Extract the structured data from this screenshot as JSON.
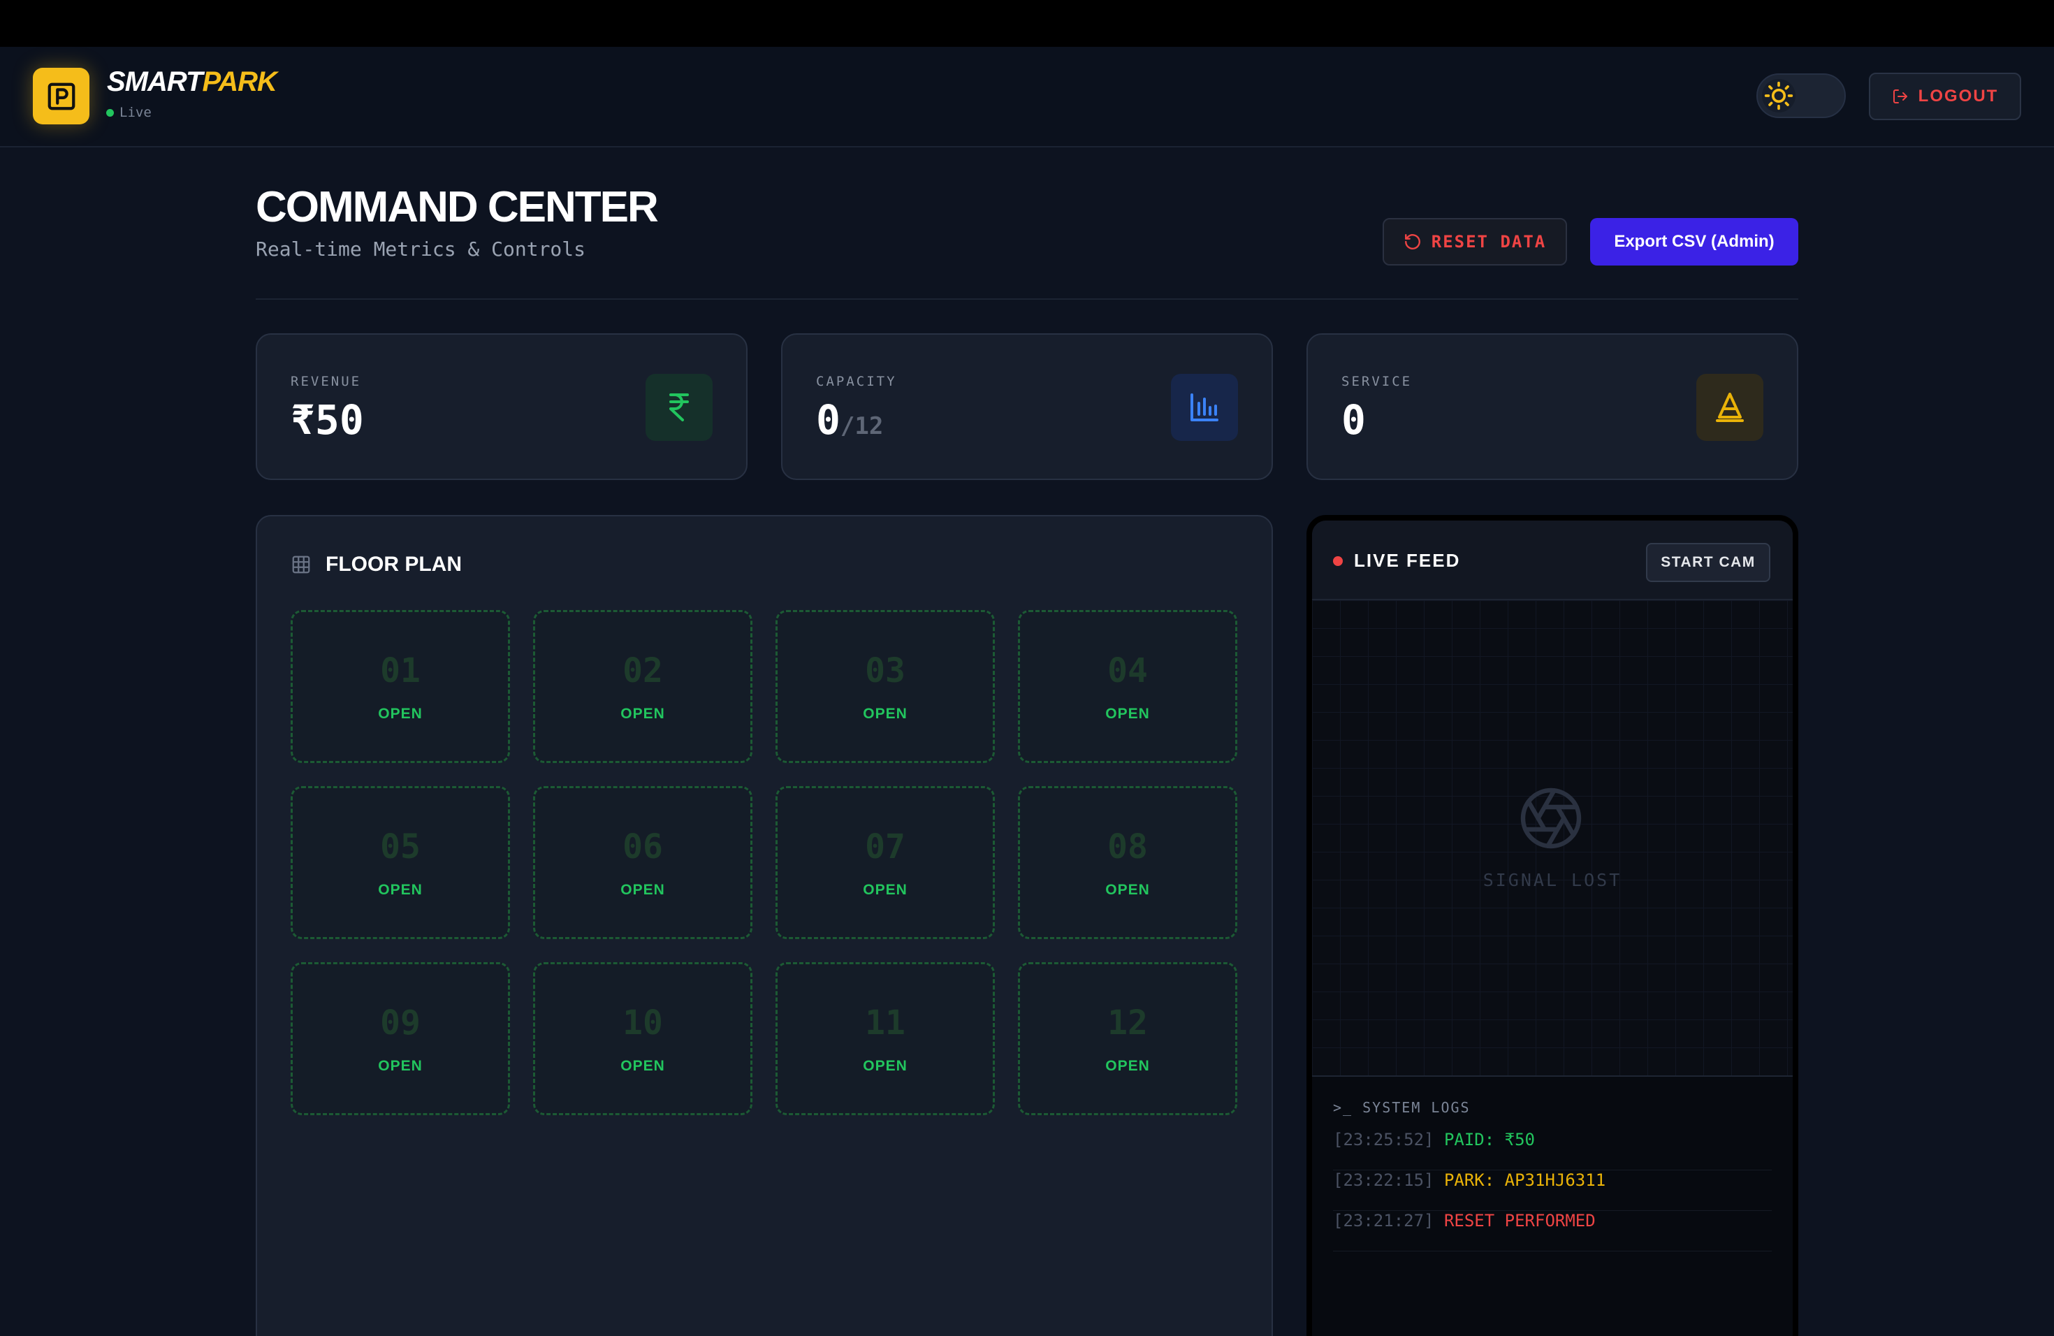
{
  "header": {
    "brand_part1": "SMART",
    "brand_part2": "PARK",
    "status": "Live",
    "logout_label": "LOGOUT"
  },
  "page": {
    "title": "COMMAND CENTER",
    "subtitle": "Real-time Metrics & Controls",
    "reset_label": "RESET DATA",
    "export_label": "Export CSV (Admin)"
  },
  "stats": [
    {
      "label": "REVENUE",
      "value": "₹50",
      "icon": "rupee-icon",
      "color": "#22c55e"
    },
    {
      "label": "CAPACITY",
      "value": "0",
      "total": "/12",
      "icon": "bar-chart-icon",
      "color": "#3b82f6"
    },
    {
      "label": "SERVICE",
      "value": "0",
      "icon": "cone-icon",
      "color": "#eab308"
    }
  ],
  "floor": {
    "title": "FLOOR PLAN",
    "slots": [
      {
        "num": "01",
        "status": "OPEN"
      },
      {
        "num": "02",
        "status": "OPEN"
      },
      {
        "num": "03",
        "status": "OPEN"
      },
      {
        "num": "04",
        "status": "OPEN"
      },
      {
        "num": "05",
        "status": "OPEN"
      },
      {
        "num": "06",
        "status": "OPEN"
      },
      {
        "num": "07",
        "status": "OPEN"
      },
      {
        "num": "08",
        "status": "OPEN"
      },
      {
        "num": "09",
        "status": "OPEN"
      },
      {
        "num": "10",
        "status": "OPEN"
      },
      {
        "num": "11",
        "status": "OPEN"
      },
      {
        "num": "12",
        "status": "OPEN"
      }
    ]
  },
  "feed": {
    "title": "LIVE FEED",
    "start_cam_label": "START CAM",
    "signal_text": "SIGNAL LOST",
    "logs_title": ">_ SYSTEM LOGS",
    "logs": [
      {
        "time": "[23:25:52]",
        "message": "PAID: ₹50",
        "color": "green"
      },
      {
        "time": "[23:22:15]",
        "message": "PARK: AP31HJ6311",
        "color": "yellow"
      },
      {
        "time": "[23:21:27]",
        "message": "RESET PERFORMED",
        "color": "red"
      }
    ]
  },
  "colors": {
    "accent": "#f5bd1a",
    "primary_button": "#3b22e6",
    "open_slot": "#22c55e",
    "danger": "#ef4444"
  }
}
